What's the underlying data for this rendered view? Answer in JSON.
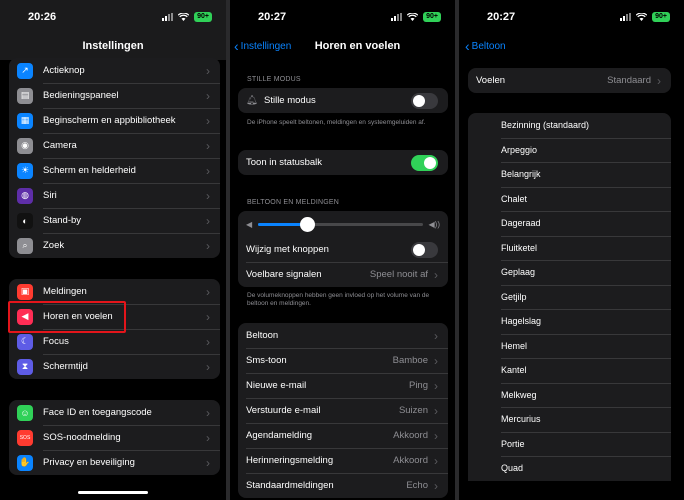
{
  "colors": {
    "accent": "#0a84ff",
    "highlight": "#e3151b",
    "toggle_on": "#30d158"
  },
  "screen1": {
    "time": "20:26",
    "battery": "90+",
    "title": "Instellingen",
    "group1": [
      {
        "label": "Actieknop",
        "icon": "action-button-icon",
        "color": "#0a84ff",
        "glyph": "↗"
      },
      {
        "label": "Bedieningspaneel",
        "icon": "control-center-icon",
        "color": "#8e8e93",
        "glyph": "▤"
      },
      {
        "label": "Beginscherm en appbibliotheek",
        "icon": "home-screen-icon",
        "color": "#0a84ff",
        "glyph": "▦"
      },
      {
        "label": "Camera",
        "icon": "camera-icon",
        "color": "#8e8e93",
        "glyph": "◉"
      },
      {
        "label": "Scherm en helderheid",
        "icon": "brightness-icon",
        "color": "#0a84ff",
        "glyph": "☀"
      },
      {
        "label": "Siri",
        "icon": "siri-icon",
        "color": "#5e2ea8",
        "glyph": "◍"
      },
      {
        "label": "Stand-by",
        "icon": "standby-icon",
        "color": "#111111",
        "glyph": "◐"
      },
      {
        "label": "Zoek",
        "icon": "search-icon",
        "color": "#8e8e93",
        "glyph": "⌕"
      }
    ],
    "group2": [
      {
        "label": "Meldingen",
        "icon": "notifications-icon",
        "color": "#ff3b30",
        "glyph": "▣"
      },
      {
        "label": "Horen en voelen",
        "icon": "speaker-icon",
        "color": "#ff2d55",
        "glyph": "◀"
      },
      {
        "label": "Focus",
        "icon": "moon-icon",
        "color": "#5e5ce6",
        "glyph": "☾"
      },
      {
        "label": "Schermtijd",
        "icon": "hourglass-icon",
        "color": "#5e5ce6",
        "glyph": "⧗"
      }
    ],
    "group3": [
      {
        "label": "Face ID en toegangscode",
        "icon": "face-id-icon",
        "color": "#30d158",
        "glyph": "☺"
      },
      {
        "label": "SOS-noodmelding",
        "icon": "sos-icon",
        "color": "#ff3b30",
        "glyph": "SOS"
      },
      {
        "label": "Privacy en beveiliging",
        "icon": "hand-icon",
        "color": "#0a84ff",
        "glyph": "✋"
      }
    ]
  },
  "screen2": {
    "time": "20:27",
    "battery": "90+",
    "back": "Instellingen",
    "title": "Horen en voelen",
    "silent_header": "STILLE MODUS",
    "silent_label": "Stille modus",
    "silent_foot": "De iPhone speelt beltonen, meldingen en systeemgeluiden af.",
    "statusbar_label": "Toon in statusbalk",
    "ring_header": "BELTOON EN MELDINGEN",
    "volume_level": 0.3,
    "buttons_label": "Wijzig met knoppen",
    "haptics_label": "Voelbare signalen",
    "haptics_value": "Speel nooit af",
    "ring_foot": "De volumeknoppen hebben geen invloed op het volume van de beltoon en meldingen.",
    "sounds": [
      {
        "label": "Beltoon",
        "value": ""
      },
      {
        "label": "Sms-toon",
        "value": "Bamboe"
      },
      {
        "label": "Nieuwe e-mail",
        "value": "Ping"
      },
      {
        "label": "Verstuurde e-mail",
        "value": "Suizen"
      },
      {
        "label": "Agendamelding",
        "value": "Akkoord"
      },
      {
        "label": "Herinneringsmelding",
        "value": "Akkoord"
      },
      {
        "label": "Standaardmeldingen",
        "value": "Echo"
      }
    ]
  },
  "screen3": {
    "time": "20:27",
    "battery": "90+",
    "back": "Beltoon",
    "vibration_label": "Voelen",
    "vibration_value": "Standaard",
    "tones": [
      "Bezinning (standaard)",
      "Arpeggio",
      "Belangrijk",
      "Chalet",
      "Dageraad",
      "Fluitketel",
      "Geplaag",
      "Getjilp",
      "Hagelslag",
      "Hemel",
      "Kantel",
      "Melkweg",
      "Mercurius",
      "Portie",
      "Quad"
    ]
  }
}
